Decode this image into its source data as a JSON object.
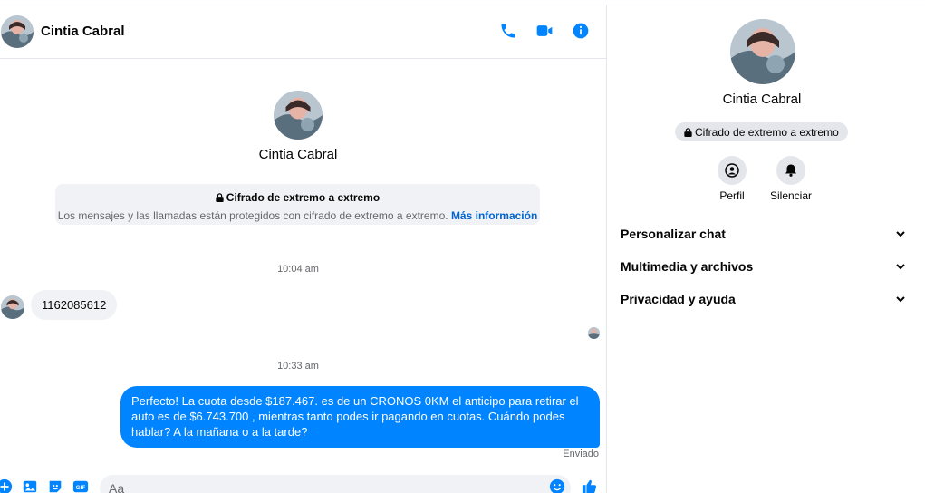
{
  "contact": {
    "name": "Cintia Cabral"
  },
  "colors": {
    "accent": "#0084ff",
    "bubble_in": "#f0f2f5",
    "link": "#0064d1"
  },
  "header": {
    "icons": [
      "phone-icon",
      "video-camera-icon",
      "info-icon"
    ]
  },
  "intro": {
    "name": "Cintia Cabral",
    "e2e_title": "Cifrado de extremo a extremo",
    "e2e_desc": "Los mensajes y las llamadas están protegidos con cifrado de extremo a extremo.",
    "e2e_link": "Más información"
  },
  "messages": {
    "time1": "10:04 am",
    "incoming_text": "1162085612",
    "time2": "10:33 am",
    "outgoing_text": "Perfecto! La cuota desde $187.467. es de un CRONOS 0KM el anticipo para retirar el auto es de $6.743.700 , mientras tanto podes ir pagando en cuotas. Cuándo podes hablar? A la mañana o a la tarde?",
    "status": "Enviado"
  },
  "composer": {
    "placeholder": "Aa",
    "icons": [
      "plus-icon",
      "image-icon",
      "sticker-icon",
      "gif-icon",
      "emoji-icon",
      "thumbs-up-icon"
    ]
  },
  "panel": {
    "name": "Cintia Cabral",
    "badge": "Cifrado de extremo a extremo",
    "actions": [
      {
        "label": "Perfil",
        "icon": "profile-icon"
      },
      {
        "label": "Silenciar",
        "icon": "bell-icon"
      }
    ],
    "rows": [
      {
        "label": "Personalizar chat"
      },
      {
        "label": "Multimedia y archivos"
      },
      {
        "label": "Privacidad y ayuda"
      }
    ]
  }
}
